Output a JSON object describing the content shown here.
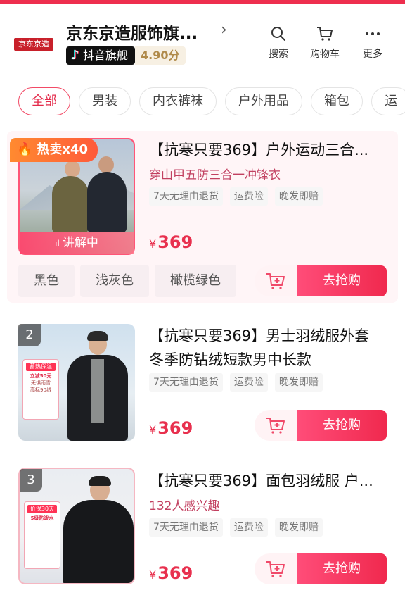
{
  "header": {
    "logo_text": "京东京造",
    "shop_name": "京东京造服饰旗...",
    "platform_badge": "抖音旗舰",
    "score": "4.90分",
    "actions": [
      {
        "label": "搜索",
        "icon": "search-icon"
      },
      {
        "label": "购物车",
        "icon": "cart-icon"
      },
      {
        "label": "更多",
        "icon": "more-icon"
      }
    ]
  },
  "tabs": [
    "全部",
    "男装",
    "内衣裤袜",
    "户外用品",
    "箱包",
    "运"
  ],
  "active_tab": "全部",
  "products": [
    {
      "title": "【抗寒只要369】户外运动三合...",
      "subtitle": "穿山甲五防三合一冲锋衣",
      "tags": [
        "7天无理由退货",
        "运费险",
        "晚发即赔"
      ],
      "price": "369",
      "currency": "¥",
      "hot_badge": "热卖x40",
      "live_label": "讲解中",
      "colors": [
        "黑色",
        "浅灰色",
        "橄榄绿色"
      ],
      "buy_label": "去抢购"
    },
    {
      "rank": "2",
      "title_line1": "【抗寒只要369】男士羽绒服外套",
      "title_line2": "冬季防钻绒短款男中长款",
      "tags": [
        "7天无理由退货",
        "运费险",
        "晚发即赔"
      ],
      "price": "369",
      "currency": "¥",
      "buy_label": "去抢购",
      "promo": [
        "蓄热保温",
        "立减50元",
        "无惧雨雪",
        "高标90绒"
      ]
    },
    {
      "rank": "3",
      "title": "【抗寒只要369】面包羽绒服 户...",
      "subtitle": "132人感兴趣",
      "tags": [
        "7天无理由退货",
        "运费险",
        "晚发即赔"
      ],
      "price": "369",
      "currency": "¥",
      "buy_label": "去抢购",
      "promo": [
        "价保30天",
        "5级防泼水"
      ]
    }
  ],
  "colors": {
    "accent": "#f0294e",
    "price": "#e8304e",
    "subtitle": "#c24060"
  }
}
